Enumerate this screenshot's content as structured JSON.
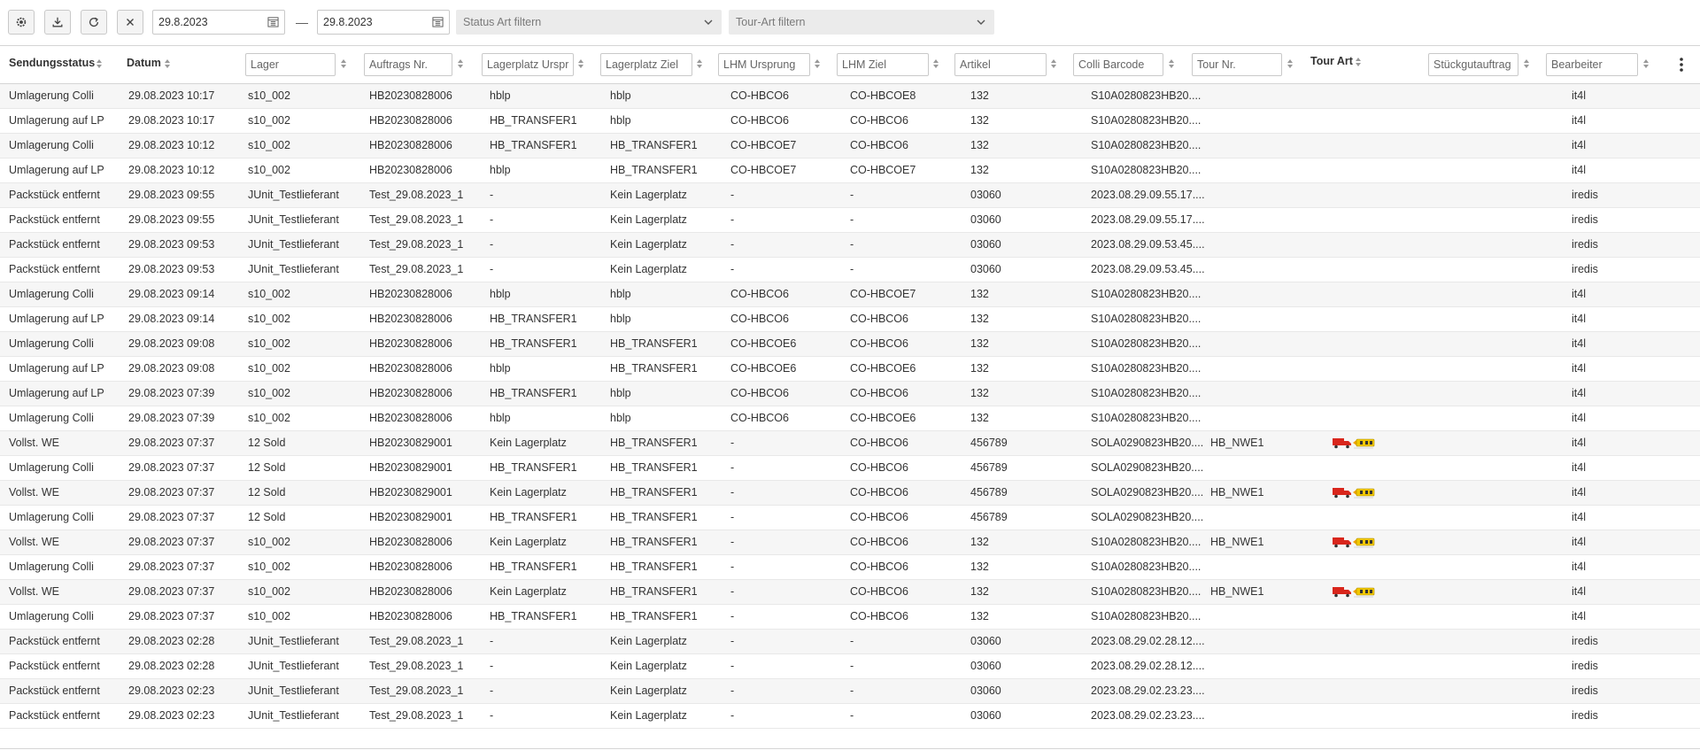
{
  "toolbar": {
    "date_from": "29.8.2023",
    "date_to": "29.8.2023",
    "status_filter_placeholder": "Status Art filtern",
    "tour_filter_placeholder": "Tour-Art filtern",
    "buttons": [
      "gear-icon",
      "download-icon",
      "refresh-icon",
      "close-icon"
    ]
  },
  "columns": {
    "status": "Sendungsstatus",
    "datum": "Datum",
    "lager": "Lager",
    "auftrag": "Auftrags Nr.",
    "lp_ursprung": "Lagerplatz Ursprung",
    "lp_ziel": "Lagerplatz Ziel",
    "lhm_ursprung": "LHM Ursprung",
    "lhm_ziel": "LHM Ziel",
    "artikel": "Artikel",
    "colli": "Colli Barcode",
    "tour": "Tour Nr.",
    "tourart": "Tour Art",
    "stueck": "Stückgutauftrag",
    "bearbeiter": "Bearbeiter"
  },
  "rows": [
    [
      "Umlagerung Colli",
      "29.08.2023 10:17",
      "s10_002",
      "HB20230828006",
      "hblp",
      "hblp",
      "CO-HBCO6",
      "CO-HBCOE8",
      "132",
      "S10A0280823HB20....",
      "",
      false,
      "",
      "it4l"
    ],
    [
      "Umlagerung auf LP",
      "29.08.2023 10:17",
      "s10_002",
      "HB20230828006",
      "HB_TRANSFER1",
      "hblp",
      "CO-HBCO6",
      "CO-HBCO6",
      "132",
      "S10A0280823HB20....",
      "",
      false,
      "",
      "it4l"
    ],
    [
      "Umlagerung Colli",
      "29.08.2023 10:12",
      "s10_002",
      "HB20230828006",
      "HB_TRANSFER1",
      "HB_TRANSFER1",
      "CO-HBCOE7",
      "CO-HBCO6",
      "132",
      "S10A0280823HB20....",
      "",
      false,
      "",
      "it4l"
    ],
    [
      "Umlagerung auf LP",
      "29.08.2023 10:12",
      "s10_002",
      "HB20230828006",
      "hblp",
      "HB_TRANSFER1",
      "CO-HBCOE7",
      "CO-HBCOE7",
      "132",
      "S10A0280823HB20....",
      "",
      false,
      "",
      "it4l"
    ],
    [
      "Packstück entfernt",
      "29.08.2023 09:55",
      "JUnit_Testlieferant",
      "Test_29.08.2023_1",
      "-",
      "Kein Lagerplatz",
      "-",
      "-",
      "03060",
      "2023.08.29.09.55.17....",
      "",
      false,
      "",
      "iredis"
    ],
    [
      "Packstück entfernt",
      "29.08.2023 09:55",
      "JUnit_Testlieferant",
      "Test_29.08.2023_1",
      "-",
      "Kein Lagerplatz",
      "-",
      "-",
      "03060",
      "2023.08.29.09.55.17....",
      "",
      false,
      "",
      "iredis"
    ],
    [
      "Packstück entfernt",
      "29.08.2023 09:53",
      "JUnit_Testlieferant",
      "Test_29.08.2023_1",
      "-",
      "Kein Lagerplatz",
      "-",
      "-",
      "03060",
      "2023.08.29.09.53.45....",
      "",
      false,
      "",
      "iredis"
    ],
    [
      "Packstück entfernt",
      "29.08.2023 09:53",
      "JUnit_Testlieferant",
      "Test_29.08.2023_1",
      "-",
      "Kein Lagerplatz",
      "-",
      "-",
      "03060",
      "2023.08.29.09.53.45....",
      "",
      false,
      "",
      "iredis"
    ],
    [
      "Umlagerung Colli",
      "29.08.2023 09:14",
      "s10_002",
      "HB20230828006",
      "hblp",
      "hblp",
      "CO-HBCO6",
      "CO-HBCOE7",
      "132",
      "S10A0280823HB20....",
      "",
      false,
      "",
      "it4l"
    ],
    [
      "Umlagerung auf LP",
      "29.08.2023 09:14",
      "s10_002",
      "HB20230828006",
      "HB_TRANSFER1",
      "hblp",
      "CO-HBCO6",
      "CO-HBCO6",
      "132",
      "S10A0280823HB20....",
      "",
      false,
      "",
      "it4l"
    ],
    [
      "Umlagerung Colli",
      "29.08.2023 09:08",
      "s10_002",
      "HB20230828006",
      "HB_TRANSFER1",
      "HB_TRANSFER1",
      "CO-HBCOE6",
      "CO-HBCO6",
      "132",
      "S10A0280823HB20....",
      "",
      false,
      "",
      "it4l"
    ],
    [
      "Umlagerung auf LP",
      "29.08.2023 09:08",
      "s10_002",
      "HB20230828006",
      "hblp",
      "HB_TRANSFER1",
      "CO-HBCOE6",
      "CO-HBCOE6",
      "132",
      "S10A0280823HB20....",
      "",
      false,
      "",
      "it4l"
    ],
    [
      "Umlagerung auf LP",
      "29.08.2023 07:39",
      "s10_002",
      "HB20230828006",
      "HB_TRANSFER1",
      "hblp",
      "CO-HBCO6",
      "CO-HBCO6",
      "132",
      "S10A0280823HB20....",
      "",
      false,
      "",
      "it4l"
    ],
    [
      "Umlagerung Colli",
      "29.08.2023 07:39",
      "s10_002",
      "HB20230828006",
      "hblp",
      "hblp",
      "CO-HBCO6",
      "CO-HBCOE6",
      "132",
      "S10A0280823HB20....",
      "",
      false,
      "",
      "it4l"
    ],
    [
      "Vollst. WE",
      "29.08.2023 07:37",
      "12 Sold",
      "HB20230829001",
      "Kein Lagerplatz",
      "HB_TRANSFER1",
      "-",
      "CO-HBCO6",
      "456789",
      "SOLA0290823HB20....",
      "HB_NWE1",
      true,
      "",
      "it4l"
    ],
    [
      "Umlagerung Colli",
      "29.08.2023 07:37",
      "12 Sold",
      "HB20230829001",
      "HB_TRANSFER1",
      "HB_TRANSFER1",
      "-",
      "CO-HBCO6",
      "456789",
      "SOLA0290823HB20....",
      "",
      false,
      "",
      "it4l"
    ],
    [
      "Vollst. WE",
      "29.08.2023 07:37",
      "12 Sold",
      "HB20230829001",
      "Kein Lagerplatz",
      "HB_TRANSFER1",
      "-",
      "CO-HBCO6",
      "456789",
      "SOLA0290823HB20....",
      "HB_NWE1",
      true,
      "",
      "it4l"
    ],
    [
      "Umlagerung Colli",
      "29.08.2023 07:37",
      "12 Sold",
      "HB20230829001",
      "HB_TRANSFER1",
      "HB_TRANSFER1",
      "-",
      "CO-HBCO6",
      "456789",
      "SOLA0290823HB20....",
      "",
      false,
      "",
      "it4l"
    ],
    [
      "Vollst. WE",
      "29.08.2023 07:37",
      "s10_002",
      "HB20230828006",
      "Kein Lagerplatz",
      "HB_TRANSFER1",
      "-",
      "CO-HBCO6",
      "132",
      "S10A0280823HB20....",
      "HB_NWE1",
      true,
      "",
      "it4l"
    ],
    [
      "Umlagerung Colli",
      "29.08.2023 07:37",
      "s10_002",
      "HB20230828006",
      "HB_TRANSFER1",
      "HB_TRANSFER1",
      "-",
      "CO-HBCO6",
      "132",
      "S10A0280823HB20....",
      "",
      false,
      "",
      "it4l"
    ],
    [
      "Vollst. WE",
      "29.08.2023 07:37",
      "s10_002",
      "HB20230828006",
      "Kein Lagerplatz",
      "HB_TRANSFER1",
      "-",
      "CO-HBCO6",
      "132",
      "S10A0280823HB20....",
      "HB_NWE1",
      true,
      "",
      "it4l"
    ],
    [
      "Umlagerung Colli",
      "29.08.2023 07:37",
      "s10_002",
      "HB20230828006",
      "HB_TRANSFER1",
      "HB_TRANSFER1",
      "-",
      "CO-HBCO6",
      "132",
      "S10A0280823HB20....",
      "",
      false,
      "",
      "it4l"
    ],
    [
      "Packstück entfernt",
      "29.08.2023 02:28",
      "JUnit_Testlieferant",
      "Test_29.08.2023_1",
      "-",
      "Kein Lagerplatz",
      "-",
      "-",
      "03060",
      "2023.08.29.02.28.12....",
      "",
      false,
      "",
      "iredis"
    ],
    [
      "Packstück entfernt",
      "29.08.2023 02:28",
      "JUnit_Testlieferant",
      "Test_29.08.2023_1",
      "-",
      "Kein Lagerplatz",
      "-",
      "-",
      "03060",
      "2023.08.29.02.28.12....",
      "",
      false,
      "",
      "iredis"
    ],
    [
      "Packstück entfernt",
      "29.08.2023 02:23",
      "JUnit_Testlieferant",
      "Test_29.08.2023_1",
      "-",
      "Kein Lagerplatz",
      "-",
      "-",
      "03060",
      "2023.08.29.02.23.23....",
      "",
      false,
      "",
      "iredis"
    ],
    [
      "Packstück entfernt",
      "29.08.2023 02:23",
      "JUnit_Testlieferant",
      "Test_29.08.2023_1",
      "-",
      "Kein Lagerplatz",
      "-",
      "-",
      "03060",
      "2023.08.29.02.23.23....",
      "",
      false,
      "",
      "iredis"
    ]
  ],
  "colors": {
    "stripe": "#f6f6f6",
    "border": "#d5d5d5",
    "truck_red": "#d9261c",
    "truck_yellow": "#f2c800"
  },
  "tour_icon": "truck-icon"
}
